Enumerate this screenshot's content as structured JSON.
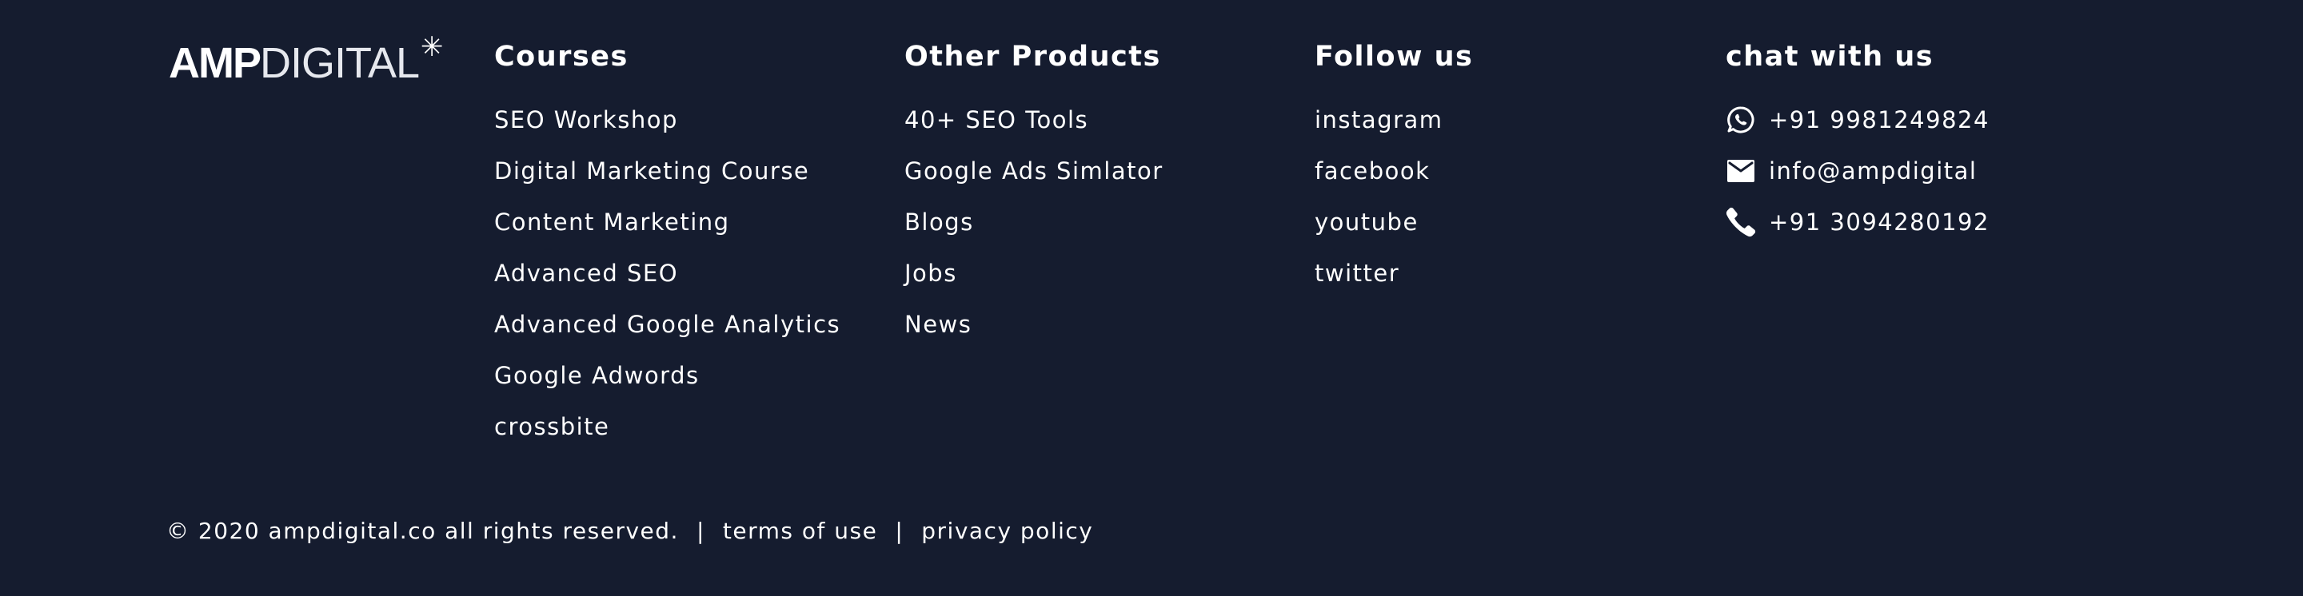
{
  "logo": {
    "part1": "AMP",
    "part2": "DIGITAL",
    "mark": "✳"
  },
  "courses": {
    "title": "Courses",
    "items": [
      "SEO Workshop",
      "Digital Marketing Course",
      "Content Marketing",
      "Advanced SEO",
      "Advanced Google Analytics",
      "Google Adwords",
      "crossbite"
    ]
  },
  "products": {
    "title": "Other Products",
    "items": [
      "40+ SEO Tools",
      "Google Ads Simlator",
      "Blogs",
      "Jobs",
      "News"
    ]
  },
  "follow": {
    "title": "Follow us",
    "items": [
      "instagram",
      "facebook",
      "youtube",
      "twitter"
    ]
  },
  "chat": {
    "title": "chat with us",
    "items": [
      {
        "icon": "whatsapp-icon",
        "text": "+91 9981249824"
      },
      {
        "icon": "mail-icon",
        "text": "info@ampdigital"
      },
      {
        "icon": "phone-icon",
        "text": "+91 3094280192"
      }
    ]
  },
  "bottom": {
    "copyright": "© 2020 ampdigital.co all rights reserved.",
    "separator": "|",
    "terms": "terms of use",
    "privacy": "privacy policy"
  },
  "colors": {
    "background": "#151c2f",
    "text": "#ffffff"
  }
}
